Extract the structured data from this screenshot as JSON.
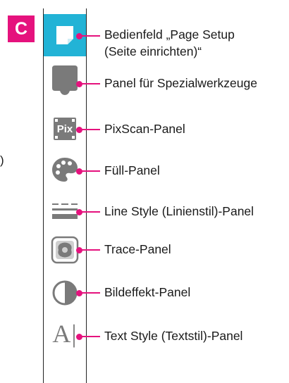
{
  "badge": "C",
  "side_fragment": ")",
  "panels": [
    {
      "icon": "page-setup-icon",
      "label_line1": "Bedienfeld „Page Setup",
      "label_line2": "(Seite einrichten)“"
    },
    {
      "icon": "special-tools-icon",
      "label": "Panel für Spezialwerkzeuge"
    },
    {
      "icon": "pixscan-icon",
      "icon_text": "Pix",
      "label": "PixScan-Panel"
    },
    {
      "icon": "palette-icon",
      "label": "Füll-Panel"
    },
    {
      "icon": "line-style-icon",
      "label": "Line Style (Linienstil)-Panel"
    },
    {
      "icon": "trace-icon",
      "label": "Trace-Panel"
    },
    {
      "icon": "image-effect-icon",
      "label": "Bildeffekt-Panel"
    },
    {
      "icon": "text-style-icon",
      "icon_text": "A|",
      "label": "Text Style (Textstil)-Panel"
    }
  ],
  "colors": {
    "accent": "#e5127d",
    "active": "#22b3d6",
    "icon_gray": "#7a7a7a"
  }
}
